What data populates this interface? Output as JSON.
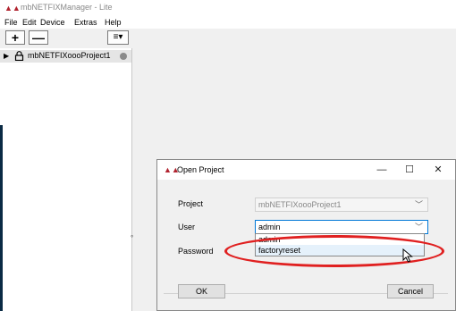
{
  "app": {
    "title": "mbNETFIXManager - Lite",
    "icon": "app-logo-icon"
  },
  "menu": [
    "File",
    "Edit",
    "Device",
    "Extras",
    "Help"
  ],
  "toolbar": {
    "add_label": "+",
    "remove_label": "—",
    "menu_label": "≡▾"
  },
  "tree": {
    "items": [
      {
        "label": "mbNETFIXoooProject1",
        "icon": "lock-icon",
        "status_color": "#8a8a8a"
      }
    ]
  },
  "dialog": {
    "title": "Open Project",
    "controls": {
      "minimize": "—",
      "maximize": "☐",
      "close": "✕"
    },
    "fields": {
      "project_label": "Project",
      "project_value": "mbNETFIXoooProject1",
      "user_label": "User",
      "user_value": "admin",
      "password_label": "Password"
    },
    "user_options": [
      "admin",
      "factoryreset"
    ],
    "ok_label": "OK",
    "cancel_label": "Cancel"
  },
  "colors": {
    "accent": "#0078d7",
    "highlight_ellipse": "#e02020",
    "logo": "#b1232f"
  }
}
